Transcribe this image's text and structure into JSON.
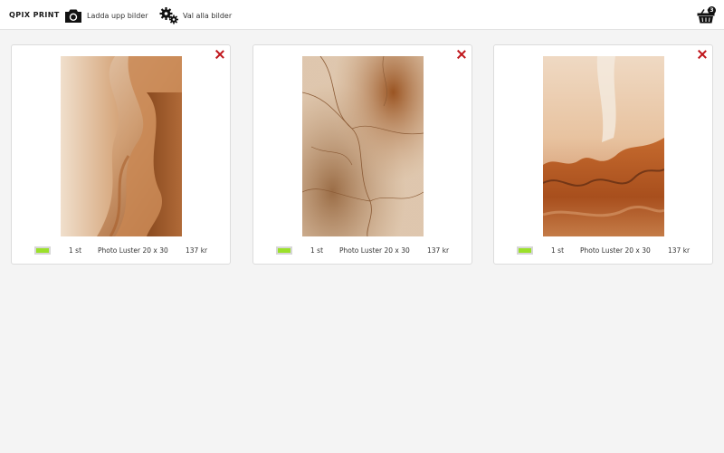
{
  "header": {
    "brand": "QPIX PRINT",
    "upload_label": "Ladda upp bilder",
    "select_all_label": "Val alla bilder",
    "cart_count": "3"
  },
  "items": [
    {
      "quantity": "1 st",
      "product": "Photo Luster 20 x 30",
      "price": "137 kr",
      "swatch_color": "#9be02a"
    },
    {
      "quantity": "1 st",
      "product": "Photo Luster 20 x 30",
      "price": "137 kr",
      "swatch_color": "#9be02a"
    },
    {
      "quantity": "1 st",
      "product": "Photo Luster 20 x 30",
      "price": "137 kr",
      "swatch_color": "#9be02a"
    }
  ],
  "colors": {
    "accent_red": "#c0161c",
    "swatch_green": "#9be02a"
  }
}
